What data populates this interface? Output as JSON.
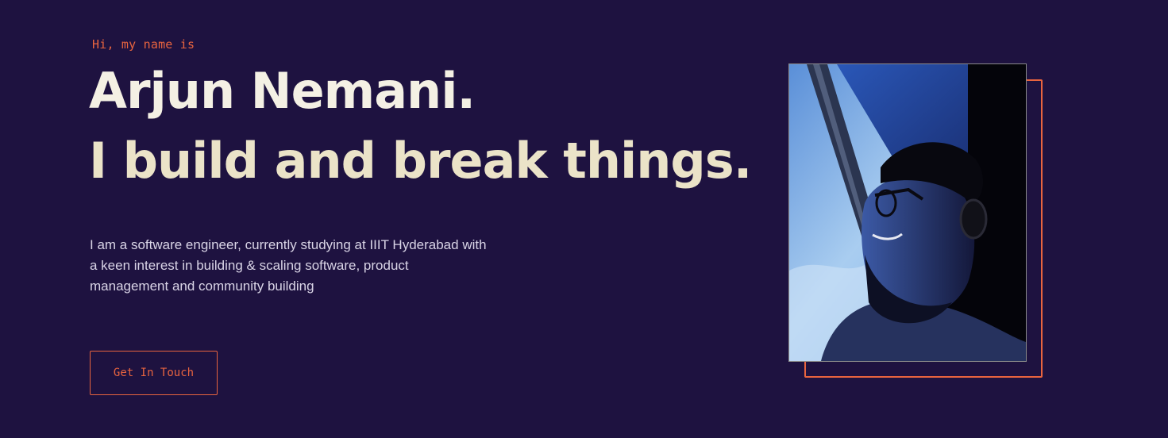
{
  "hero": {
    "greeting": "Hi, my name is",
    "name": "Arjun Nemani.",
    "tagline": "I build and break things.",
    "bio": "I am a software engineer, currently studying at IIIT Hyderabad with a keen interest in building & scaling software, product management and community building",
    "cta_label": "Get In Touch"
  },
  "colors": {
    "background": "#1e1240",
    "accent": "#e8643f",
    "heading": "#f4f0e4",
    "text": "#d9d4e6"
  }
}
